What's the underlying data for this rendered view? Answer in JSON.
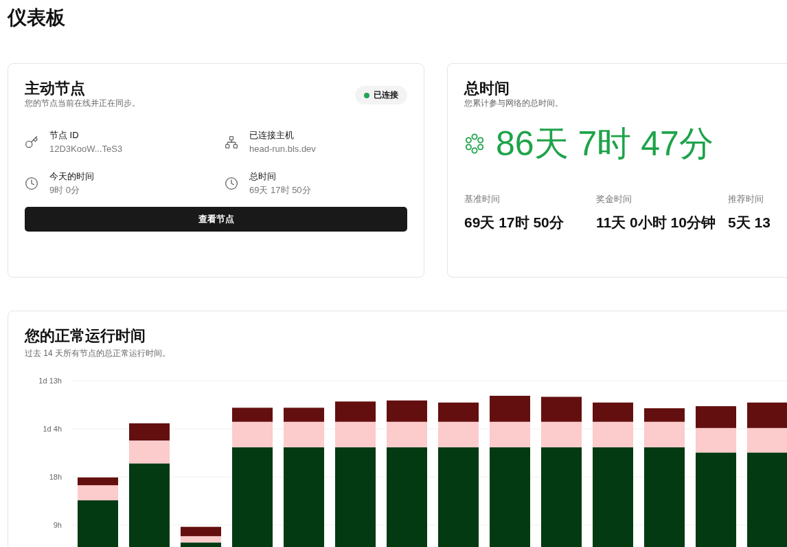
{
  "page_title": "仪表板",
  "active_node": {
    "title": "主动节点",
    "subtitle": "您的节点当前在线并正在同步。",
    "status": {
      "label": "已连接",
      "connected": true
    },
    "details": [
      {
        "kind": "key",
        "label": "节点 ID",
        "value": "12D3KooW...TeS3"
      },
      {
        "kind": "network",
        "label": "已连接主机",
        "value": "head-run.bls.dev"
      },
      {
        "kind": "clock",
        "label": "今天的时间",
        "value": "9时 0分"
      },
      {
        "kind": "clock",
        "label": "总时间",
        "value": "69天 17时 50分"
      }
    ],
    "button": "查看节点"
  },
  "total_time": {
    "title": "总时间",
    "subtitle": "您累计参与网络的总时间。",
    "value": "86天 7时 47分",
    "breakdown": [
      {
        "label": "基准时间",
        "value": "69天 17时 50分"
      },
      {
        "label": "奖金时间",
        "value": "11天 0小时 10分钟"
      },
      {
        "label": "推荐时间",
        "value": "5天 13"
      }
    ]
  },
  "uptime": {
    "title": "您的正常运行时间",
    "subtitle": "过去 14 天所有节点的总正常运行时间。",
    "chart_data": {
      "type": "bar",
      "stacked": true,
      "grid": true,
      "orientation": "vertical",
      "ylim": [
        0,
        37
      ],
      "yticks": [
        {
          "value": 9.25,
          "label": "9h"
        },
        {
          "value": 18.5,
          "label": "18h"
        },
        {
          "value": 27.75,
          "label": "1d 4h"
        },
        {
          "value": 37,
          "label": "1d 13h"
        }
      ],
      "series": [
        {
          "color": "#033a12",
          "values": [
            14.0,
            21.1,
            5.9,
            24.2,
            24.2,
            24.2,
            24.2,
            24.2,
            24.2,
            24.2,
            24.2,
            24.2,
            23.2,
            23.2
          ]
        },
        {
          "color": "#fccbcb",
          "values": [
            2.9,
            4.4,
            1.2,
            4.9,
            4.9,
            4.9,
            4.9,
            4.9,
            4.9,
            4.9,
            4.9,
            4.9,
            4.7,
            4.7
          ]
        },
        {
          "color": "#640f0f",
          "values": [
            1.5,
            3.3,
            1.8,
            2.7,
            2.7,
            3.9,
            4.1,
            3.7,
            5.0,
            4.8,
            3.7,
            2.6,
            4.2,
            4.9
          ]
        }
      ]
    }
  }
}
